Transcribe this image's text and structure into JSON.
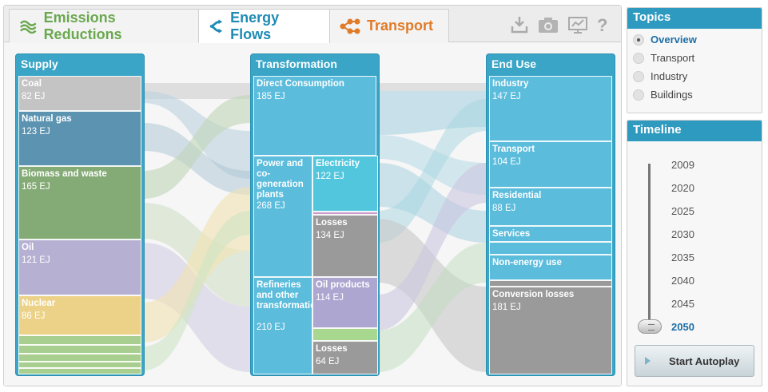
{
  "tabs": [
    {
      "label": "Emissions Reductions",
      "icon": "emissions-wave-icon",
      "color": "#6aa84f"
    },
    {
      "label": "Energy Flows",
      "icon": "flow-split-icon",
      "color": "#1e8bb5",
      "active": true
    },
    {
      "label": "Transport",
      "icon": "transport-network-icon",
      "color": "#e07b29"
    }
  ],
  "toolbar": {
    "icons": [
      "download-icon",
      "camera-icon",
      "presentation-icon",
      "help-icon"
    ]
  },
  "sankey": {
    "supply": {
      "title": "Supply",
      "nodes": [
        {
          "label": "Coal",
          "value": "82 EJ",
          "color": "#c4c4c4"
        },
        {
          "label": "Natural gas",
          "value": "123 EJ",
          "color": "#5b93b0"
        },
        {
          "label": "Biomass and waste",
          "value": "165 EJ",
          "color": "#84ab75"
        },
        {
          "label": "Oil",
          "value": "121 EJ",
          "color": "#b6b1d3"
        },
        {
          "label": "Nuclear",
          "value": "86 EJ",
          "color": "#ecd288"
        }
      ]
    },
    "transformation": {
      "title": "Transformation",
      "nodes": [
        {
          "label": "Direct Consumption",
          "value": "185 EJ"
        },
        {
          "label": "Power and co-generation plants",
          "value": "268 EJ"
        },
        {
          "label": "Electricity",
          "value": "122 EJ"
        },
        {
          "label": "Losses",
          "value": "134 EJ"
        },
        {
          "label": "Refineries and other transformation",
          "value": "210 EJ"
        },
        {
          "label": "Oil products",
          "value": "114 EJ"
        },
        {
          "label": "Losses",
          "value": "64 EJ"
        }
      ]
    },
    "end_use": {
      "title": "End Use",
      "nodes": [
        {
          "label": "Industry",
          "value": "147 EJ"
        },
        {
          "label": "Transport",
          "value": "104 EJ"
        },
        {
          "label": "Residential",
          "value": "88 EJ"
        },
        {
          "label": "Services",
          "value": ""
        },
        {
          "label": "Non-energy use",
          "value": ""
        },
        {
          "label": "Conversion losses",
          "value": "181 EJ"
        }
      ]
    }
  },
  "topics": {
    "title": "Topics",
    "items": [
      {
        "label": "Overview",
        "selected": true
      },
      {
        "label": "Transport",
        "selected": false
      },
      {
        "label": "Industry",
        "selected": false
      },
      {
        "label": "Buildings",
        "selected": false
      }
    ]
  },
  "timeline": {
    "title": "Timeline",
    "years": [
      "2009",
      "2020",
      "2025",
      "2030",
      "2035",
      "2040",
      "2045",
      "2050"
    ],
    "selected": "2050",
    "autoplay_label": "Start Autoplay"
  }
}
